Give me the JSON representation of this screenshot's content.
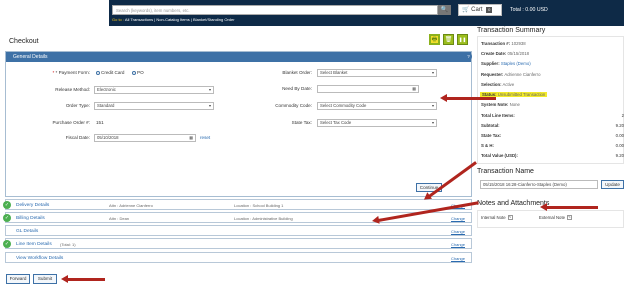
{
  "header": {
    "search_placeholder": "Search (keywords), item numbers, etc.",
    "search_icon_glyph": "🔍",
    "cart_label": "Cart",
    "cart_count": "0",
    "total": "Total : 0.00 USD",
    "goto_label": "Go to :",
    "goto_links": "All Transactions | Non-Catalog Items | Blanket/Standing Order"
  },
  "page_title": "Checkout",
  "toolbar": {
    "print": "🖶",
    "delete": "🗑",
    "pause": "❚❚"
  },
  "general": {
    "header": "General Details",
    "payment_form_label": "* Payment Form:",
    "payment_opt1": "Credit Card",
    "payment_opt2": "PO",
    "release_method_label": "Release Method:",
    "release_method_value": "Electronic",
    "order_type_label": "Order Type:",
    "order_type_value": "Standard",
    "po_number_label": "Purchase Order #:",
    "po_number_value": "151",
    "fiscal_date_label": "Fiscal Date:",
    "fiscal_date_value": "05/10/2018",
    "reset_label": "reset",
    "blanket_order_label": "Blanket Order:",
    "blanket_order_value": "Select Blanket",
    "need_by_label": "Need By Date:",
    "commodity_label": "Commodity Code:",
    "commodity_value": "Select Commodity Code",
    "state_tax_label": "State Tax:",
    "state_tax_value": "Select Tax Code",
    "continue_label": "Continue"
  },
  "sections": [
    {
      "title": "Delivery Details",
      "attn": "Attn : Adrienne Cianferro",
      "location": "Location : School Building 1",
      "change": "Change"
    },
    {
      "title": "Billing Details",
      "attn": "Attn : Dean",
      "location": "Location : Administrative Building",
      "change": "Change"
    },
    {
      "title": "GL Details",
      "change": "Change"
    },
    {
      "title": "Line Item Details",
      "count": "(Total: 1)",
      "change": "Change"
    },
    {
      "title": "View Workflow Details",
      "change": "Change"
    }
  ],
  "buttons": {
    "forward": "Forward",
    "submit": "Submit"
  },
  "summary": {
    "title": "Transaction Summary",
    "transaction_no_label": "Transaction #:",
    "transaction_no": "102938",
    "create_date_label": "Create Date:",
    "create_date": "05/15/2018",
    "supplier_label": "Supplier:",
    "supplier": "Staples (Demo)",
    "requester_label": "Requester:",
    "requester": "Adrienne Cianferro",
    "selection_label": "Selection:",
    "selection": "Active",
    "status_label": "Status:",
    "status": "Unsubmitted Transaction",
    "system_note_label": "System Note:",
    "system_note": "None",
    "total_line_items_label": "Total Line Items:",
    "total_line_items": "2",
    "subtotal_label": "Subtotal:",
    "subtotal": "9.20",
    "state_tax_label": "State Tax:",
    "state_tax": "0.00",
    "s_h_label": "S & H:",
    "s_h": "0.00",
    "total_value_label": "Total Value (USD):",
    "total_value": "9.20"
  },
  "transaction_name": {
    "title": "Transaction Name",
    "value": "05/15/2018 16:28-Cianferro-Staples (Demo)",
    "update_label": "Update"
  },
  "notes": {
    "title": "Notes and Attachments",
    "internal_label": "Internal Note",
    "external_label": "External Note",
    "edit_glyph": "✎"
  },
  "colors": {
    "header_bg": "#0e2a47",
    "panel_header": "#3e71a6",
    "highlight": "#f2ea2a",
    "arrow": "#b0251e",
    "check": "#4caf50"
  }
}
